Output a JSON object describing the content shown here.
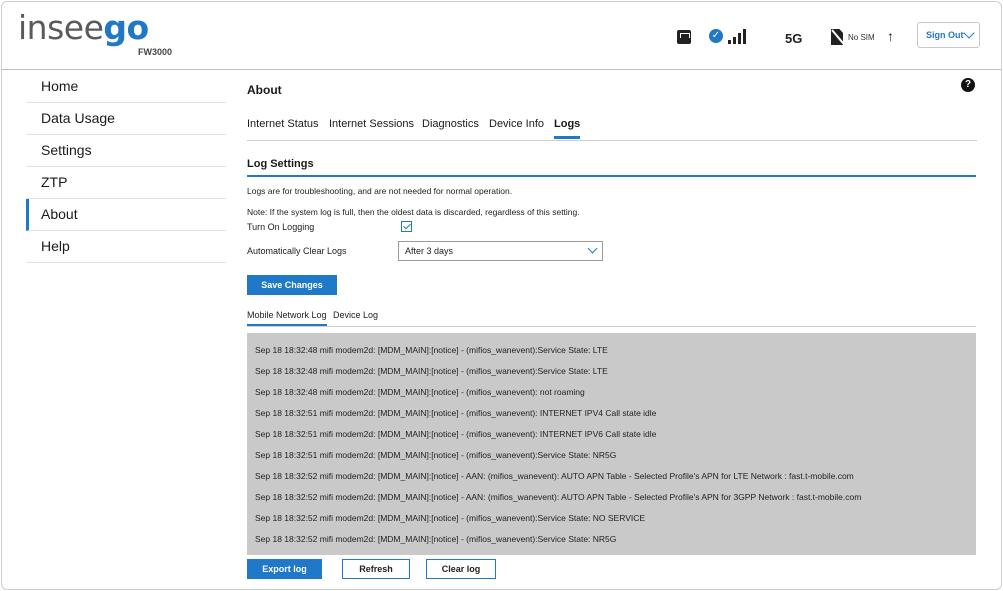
{
  "header": {
    "logo_part1": "insee",
    "logo_part2": "go",
    "model": "FW3000",
    "network_type": "5G",
    "sim_status": "No SIM",
    "sign_out_label": "Sign Out"
  },
  "sidebar": {
    "items": [
      {
        "label": "Home"
      },
      {
        "label": "Data Usage"
      },
      {
        "label": "Settings"
      },
      {
        "label": "ZTP"
      },
      {
        "label": "About",
        "active": true
      },
      {
        "label": "Help"
      }
    ]
  },
  "main": {
    "title": "About",
    "help_label": "?",
    "tabs": [
      {
        "label": "Internet Status"
      },
      {
        "label": "Internet Sessions"
      },
      {
        "label": "Diagnostics"
      },
      {
        "label": "Device Info"
      },
      {
        "label": "Logs",
        "active": true
      }
    ],
    "log_settings": {
      "title": "Log Settings",
      "note1": "Logs are for troubleshooting, and are not needed for normal operation.",
      "note2": "Note: If the system log is full, then the oldest data is discarded, regardless of this setting.",
      "turn_on_logging_label": "Turn On Logging",
      "turn_on_logging_checked": true,
      "auto_clear_label": "Automatically Clear Logs",
      "auto_clear_value": "After 3 days",
      "save_label": "Save Changes"
    },
    "log_tabs": [
      {
        "label": "Mobile Network Log",
        "active": true
      },
      {
        "label": "Device Log"
      }
    ],
    "log_lines": [
      "Sep 18 18:32:48 mifi modem2d: [MDM_MAIN]:[notice] - (mifios_wanevent):Service State: LTE",
      "Sep 18 18:32:48 mifi modem2d: [MDM_MAIN]:[notice] - (mifios_wanevent):Service State: LTE",
      "Sep 18 18:32:48 mifi modem2d: [MDM_MAIN]:[notice] - (mifios_wanevent): not roaming",
      "Sep 18 18:32:51 mifi modem2d: [MDM_MAIN]:[notice] - (mifios_wanevent): INTERNET IPV4 Call state idle",
      "Sep 18 18:32:51 mifi modem2d: [MDM_MAIN]:[notice] - (mifios_wanevent): INTERNET IPV6 Call state idle",
      "Sep 18 18:32:51 mifi modem2d: [MDM_MAIN]:[notice] - (mifios_wanevent):Service State: NR5G",
      "Sep 18 18:32:52 mifi modem2d: [MDM_MAIN]:[notice] - AAN: (mifios_wanevent): AUTO APN Table - Selected Profile's APN for LTE Network : fast.t-mobile.com",
      "Sep 18 18:32:52 mifi modem2d: [MDM_MAIN]:[notice] - AAN: (mifios_wanevent): AUTO APN Table - Selected Profile's APN for 3GPP Network : fast.t-mobile.com",
      "Sep 18 18:32:52 mifi modem2d: [MDM_MAIN]:[notice] - (mifios_wanevent):Service State: NO SERVICE",
      "Sep 18 18:32:52 mifi modem2d: [MDM_MAIN]:[notice] - (mifios_wanevent):Service State: NR5G"
    ],
    "actions": {
      "export_label": "Export log",
      "refresh_label": "Refresh",
      "clear_label": "Clear log"
    }
  }
}
